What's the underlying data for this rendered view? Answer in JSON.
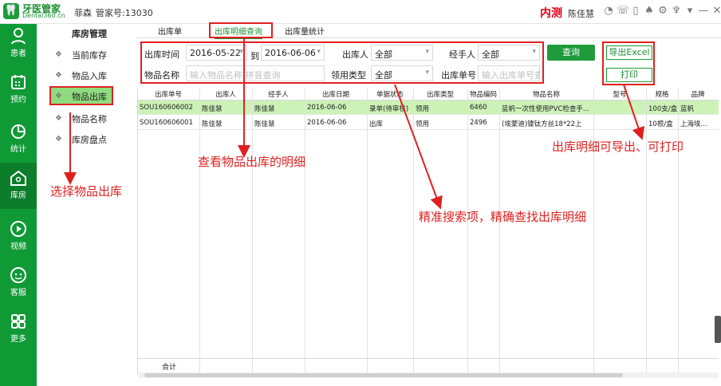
{
  "titlebar": {
    "logo_brand": "牙医管家",
    "logo_sub": "Dental360.cn",
    "clinic": "菲森",
    "account": "管家号:13030",
    "env_badge": "内测",
    "username": "陈佳慧",
    "icons": [
      "chat-icon",
      "phone-icon",
      "window-icon",
      "bell-icon",
      "settings-icon",
      "tshirt-icon",
      "wifi-icon",
      "minimize-icon",
      "close-icon"
    ]
  },
  "leftnav": {
    "items": [
      {
        "label": "患者",
        "icon": "person-icon"
      },
      {
        "label": "预约",
        "icon": "calendar-icon"
      },
      {
        "label": "统计",
        "icon": "pie-chart-icon"
      },
      {
        "label": "库房",
        "icon": "warehouse-icon"
      },
      {
        "label": "视频",
        "icon": "play-icon"
      },
      {
        "label": "客服",
        "icon": "service-icon"
      },
      {
        "label": "更多",
        "icon": "grid-icon"
      }
    ]
  },
  "submenu": {
    "title": "库房管理",
    "items": [
      "当前库存",
      "物品入库",
      "物品出库",
      "物品名称",
      "库房盘点"
    ]
  },
  "tabs": [
    "出库单",
    "出库明细查询",
    "出库量统计"
  ],
  "filters": {
    "date_label": "出库时间",
    "date_from": "2016-05-22",
    "to_label": "到",
    "date_to": "2016-06-06",
    "operator_label": "出库人",
    "operator_value": "全部",
    "handler_label": "经手人",
    "handler_value": "全部",
    "item_label": "物品名称",
    "item_placeholder": "输入物品名称,拼音查询",
    "type_label": "领用类型",
    "type_value": "全部",
    "order_label": "出库单号",
    "order_placeholder": "输入出库单号查"
  },
  "buttons": {
    "query": "查询",
    "export": "导出Excel",
    "print": "打印"
  },
  "table": {
    "columns": [
      "出库单号",
      "出库人",
      "经手人",
      "出库日期",
      "单据状态",
      "出库类型",
      "物品编码",
      "物品名称",
      "型号",
      "规格",
      "品牌"
    ],
    "rows": [
      [
        "SOU160606002",
        "陈佳慧",
        "陈佳慧",
        "2016-06-06",
        "录单(待审核)",
        "领用",
        "6460",
        "蓝帆一次性使用PVC检查手...",
        "",
        "100支/盒",
        "蓝帆"
      ],
      [
        "SOU160606001",
        "陈佳慧",
        "陈佳慧",
        "2016-06-06",
        "出库",
        "领用",
        "2496",
        "(埃蒙迪)镍钛方丝18*22上",
        "",
        "10根/盒",
        "上海埃..."
      ]
    ],
    "footer_label": "合计"
  },
  "annotations": {
    "select_outbound": "选择物品出库",
    "view_details": "查看物品出库的明细",
    "precise_search": "精准搜索项，精确查找出库明细",
    "export_print": "出库明细可导出、可打印"
  },
  "colors": {
    "brand_green": "#0f9a36",
    "annotation_red": "#e02020",
    "selected_row": "#cdf2b8",
    "active_submenu": "#8fdc7e"
  }
}
